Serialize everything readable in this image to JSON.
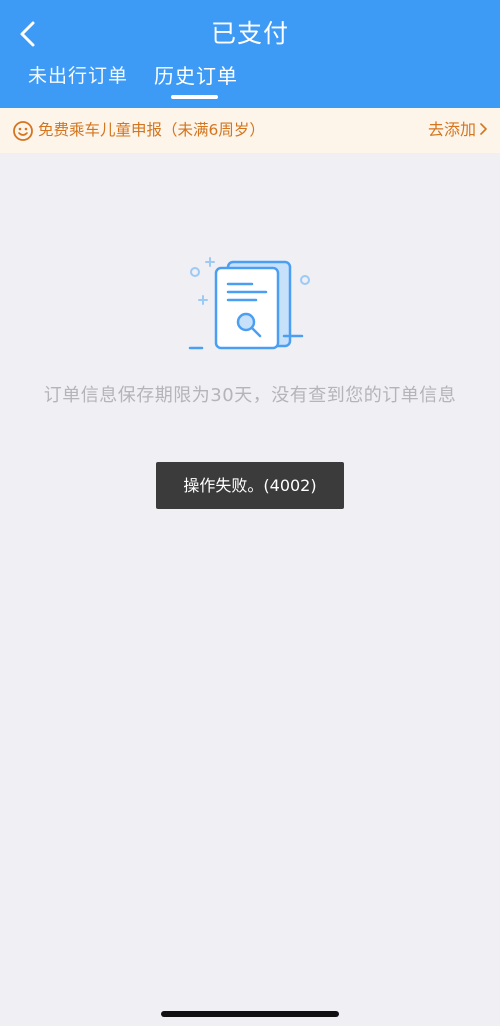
{
  "header": {
    "title": "已支付",
    "back_icon": "chevron-left-icon",
    "background_color": "#3d9af5",
    "tabs": [
      {
        "label": "未出行订单",
        "active": false
      },
      {
        "label": "历史订单",
        "active": true
      }
    ]
  },
  "notice": {
    "icon": "smiley-icon",
    "text": "免费乘车儿童申报（未满6周岁）",
    "action_label": "去添加",
    "action_icon": "chevron-right-icon",
    "text_color": "#d4761f",
    "background_color": "#fdf4ea"
  },
  "empty_state": {
    "illustration_icon": "document-search-icon",
    "message": "订单信息保存期限为30天，没有查到您的订单信息"
  },
  "toast": {
    "message": "操作失败。(4002)"
  }
}
